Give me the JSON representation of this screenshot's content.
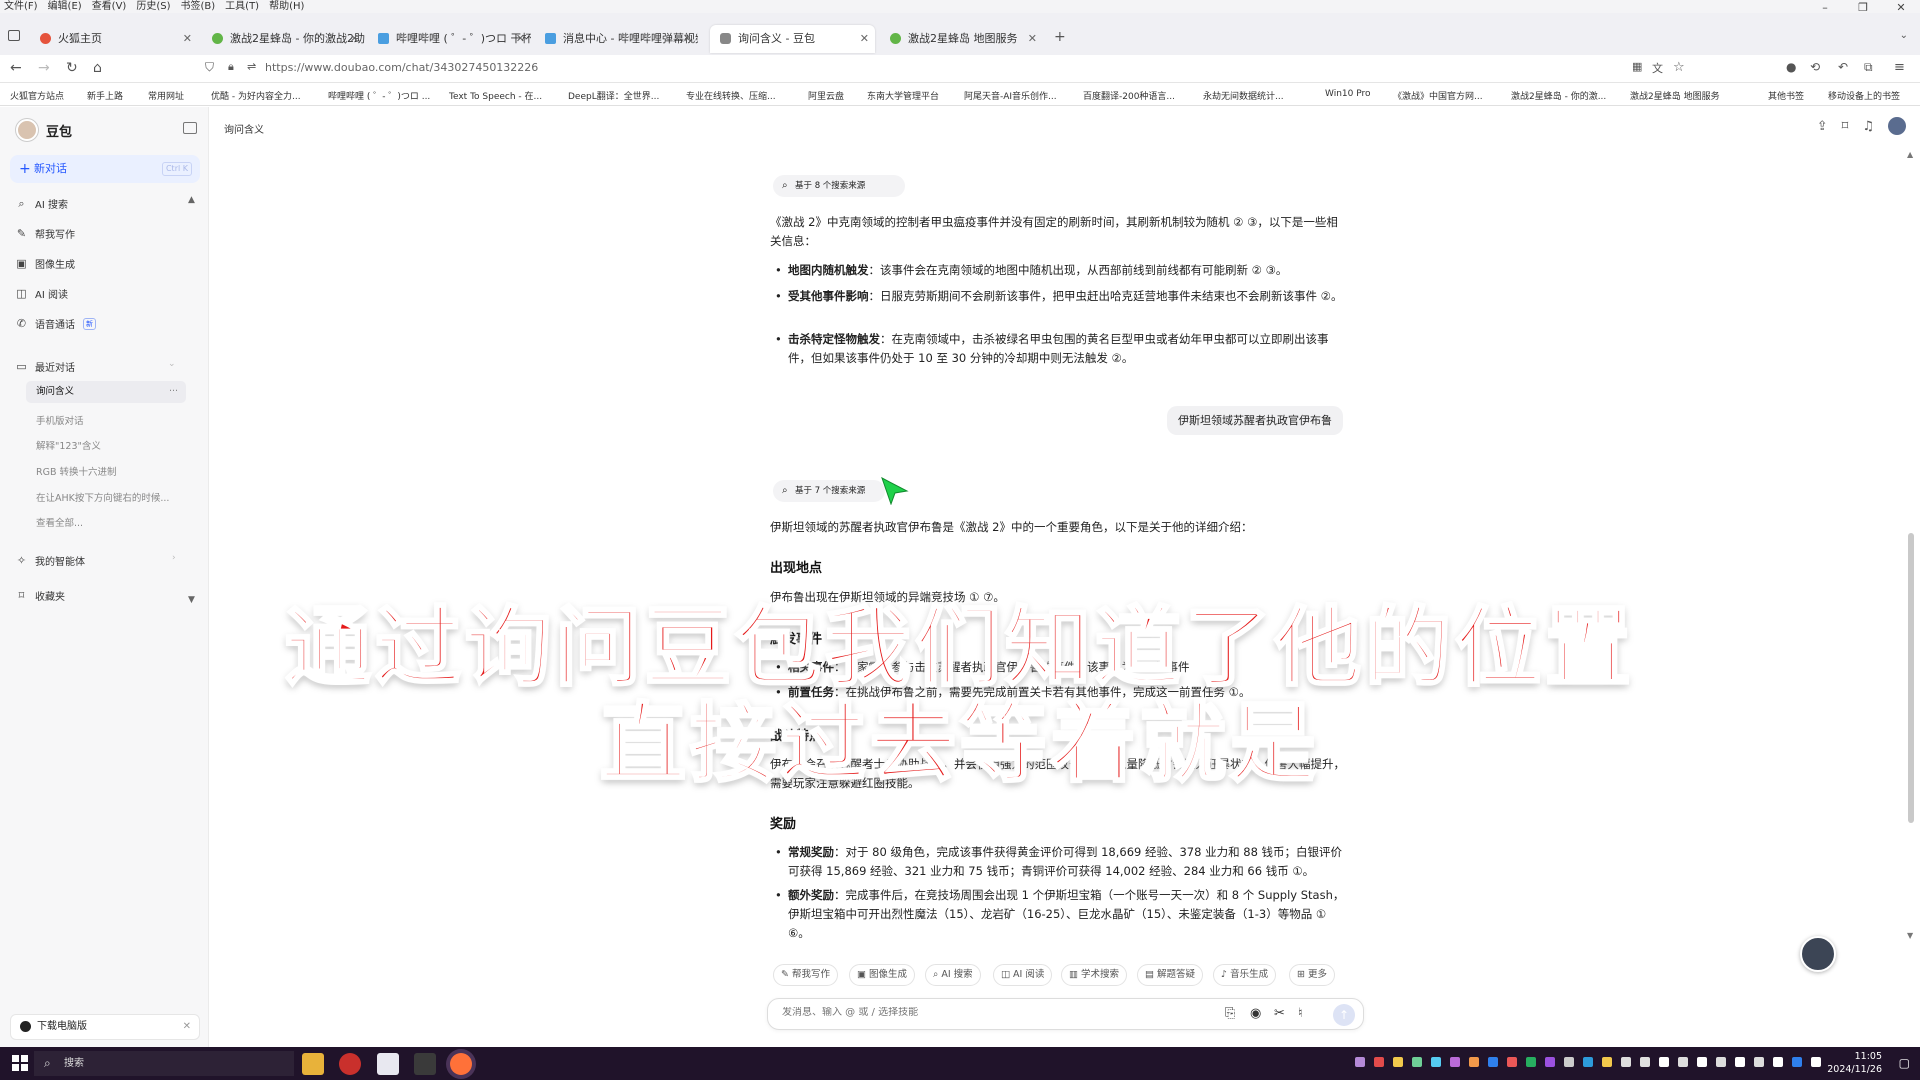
{
  "menubar": {
    "items": [
      "文件(F)",
      "编辑(E)",
      "查看(V)",
      "历史(S)",
      "书签(B)",
      "工具(T)",
      "帮助(H)"
    ]
  },
  "tabs": [
    {
      "label": "火狐主页",
      "color": "#e5533c"
    },
    {
      "label": "激战2星蜂岛 - 你的激战2助手",
      "color": "#62b547"
    },
    {
      "label": "哔哩哔哩 ( ゜- ゜)つロ 干杯~-bi",
      "color": "#4a9ee0"
    },
    {
      "label": "消息中心 - 哔哩哔哩弹幕视频网",
      "color": "#4a9ee0"
    },
    {
      "label": "询问含义 - 豆包",
      "color": "#888888"
    },
    {
      "label": "激战2星蜂岛 地图服务",
      "color": "#62b547"
    }
  ],
  "new_tab_symbol": "+",
  "nav": {
    "url": "https://www.doubao.com/chat/343027450132226"
  },
  "bookmarks": [
    "火狐官方站点",
    "新手上路",
    "常用网址",
    "优酷 - 为好内容全力...",
    "哔哩哔哩 ( ゜- ゜)つロ ...",
    "Text To Speech - 在...",
    "DeepL翻译：全世界...",
    "专业在线转换、压缩...",
    "阿里云盘",
    "东南大学管理平台",
    "阿尾天音-AI音乐创作...",
    "百度翻译-200种语言...",
    "永劫无间数据统计...",
    "Win10 Pro",
    "《激战》中国官方网...",
    "激战2星蜂岛 - 你的激...",
    "激战2星蜂岛 地图服务",
    "其他书签",
    "移动设备上的书签"
  ],
  "sidebar": {
    "brand": "豆包",
    "new_chat": "新对话",
    "new_chat_shortcut": "Ctrl K",
    "items": [
      {
        "label": "AI 搜索",
        "icon": "search-icon",
        "glyph": "⌕"
      },
      {
        "label": "帮我写作",
        "icon": "pen-icon",
        "glyph": "✎"
      },
      {
        "label": "图像生成",
        "icon": "image-icon",
        "glyph": "▣"
      },
      {
        "label": "AI 阅读",
        "icon": "book-icon",
        "glyph": "◫"
      },
      {
        "label": "语音通话",
        "icon": "phone-icon",
        "glyph": "✆",
        "badge": "新"
      }
    ],
    "recent_label": "最近对话",
    "recent": [
      "询问含义",
      "手机版对话",
      "解释\"123\"含义",
      "RGB 转换十六进制",
      "在让AHK按下方向键右的时候...",
      "查看全部..."
    ],
    "agents": "我的智能体",
    "favorites": "收藏夹",
    "download": "下载电脑版"
  },
  "conversation": {
    "title": "询问含义",
    "search_pill_1": "基于 8 个搜索来源",
    "answer_1_intro": "《激战 2》中克南领域的控制者甲虫瘟疫事件并没有固定的刷新时间，其刷新机制较为随机 ② ③，以下是一些相关信息：",
    "answer_1_bullets": [
      {
        "title": "地图内随机触发",
        "text": "：该事件会在克南领域的地图中随机出现，从西部前线到前线都有可能刷新 ② ③。"
      },
      {
        "title": "受其他事件影响",
        "text": "：日服克劳斯期间不会刷新该事件，把甲虫赶出哈克廷营地事件未结束也不会刷新该事件 ②。"
      },
      {
        "title": "击杀特定怪物触发",
        "text": "：在克南领域中，击杀被绿名甲虫包围的黄名巨型甲虫或者幼年甲虫都可以立即刷出该事件，但如果该事件仍处于 10 至 30 分钟的冷却期中则无法触发 ②。"
      }
    ],
    "user_message": "伊斯坦领域苏醒者执政官伊布鲁",
    "search_pill_2": "基于 7 个搜索来源",
    "answer_2_intro": "伊斯坦领域的苏醒者执政官伊布鲁是《激战 2》中的一个重要角色，以下是关于他的详细介绍：",
    "heading_location": "出现地点",
    "location_text": "伊布鲁出现在伊斯坦领域的异端竞技场 ① ⑦。",
    "heading_event": "触发事件",
    "event_bullets": [
      {
        "title": "相关事件",
        "text": "：玩家需要参与击败苏醒者执政官伊布鲁的事件，该事件为 80 级事件"
      },
      {
        "title": "前置任务",
        "text": "：在挑战伊布鲁之前，需要先完成前置关卡若有其他事件，完成这一前置任务 ①。"
      }
    ],
    "heading_battle": "战斗特点",
    "battle_text": "伊布鲁会召唤苏醒者士兵协助战斗，并会使用强力的范围攻击，当其血量降低时会进入狂暴状态，伤害大幅提升，需要玩家注意躲避红圈技能。",
    "heading_reward": "奖励",
    "reward_bullets": [
      {
        "title": "常规奖励",
        "text": "：对于 80 级角色，完成该事件获得黄金评价可得到 18,669 经验、378 业力和 88 钱币；白银评价可获得 15,869 经验、321 业力和 75 钱币；青铜评价可获得 14,002 经验、284 业力和 66 钱币 ①。"
      },
      {
        "title": "额外奖励",
        "text": "：完成事件后，在竞技场周围会出现 1 个伊斯坦宝箱（一个账号一天一次）和 8 个 Supply Stash，伊斯坦宝箱中可开出烈性魔法（15）、龙岩矿（16-25）、巨龙水晶矿（15）、未鉴定装备（1-3）等物品 ① ⑥。"
      }
    ]
  },
  "tools": [
    "帮我写作",
    "图像生成",
    "AI 搜索",
    "AI 阅读",
    "学术搜索",
    "解题答疑",
    "音乐生成",
    "更多"
  ],
  "input": {
    "placeholder": "发消息、输入 @ 或 / 选择技能"
  },
  "overlay": {
    "line1": "通过询问豆包我们知道了他的位置",
    "line2": "直接过去等着就是"
  },
  "taskbar": {
    "search": "搜索",
    "time": "11:05",
    "date": "2024/11/26"
  }
}
